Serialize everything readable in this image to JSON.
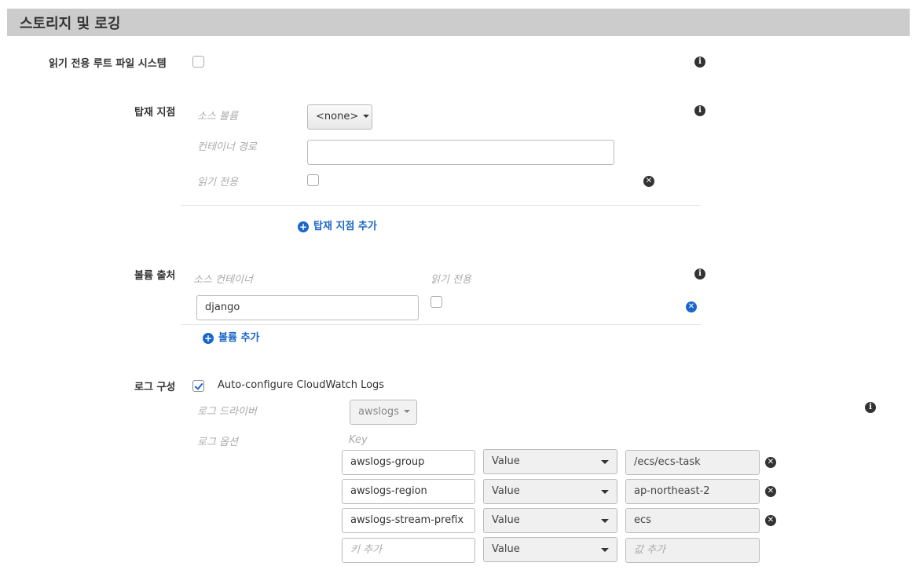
{
  "section": {
    "title": "스토리지 및 로깅"
  },
  "readonly_root": {
    "label": "읽기 전용 루트 파일 시스템",
    "checked": false
  },
  "mount_points": {
    "label": "탑재 지점",
    "source_volume_label": "소스 볼륨",
    "source_volume_value": "<none>",
    "container_path_label": "컨테이너 경로",
    "container_path_value": "",
    "read_only_label": "읽기 전용",
    "add_label": "탑재 지점 추가"
  },
  "volumes_from": {
    "label": "볼륨 출처",
    "source_container_label": "소스 컨테이너",
    "read_only_label": "읽기 전용",
    "source_container_value": "django",
    "add_label": "볼륨 추가"
  },
  "log_config": {
    "label": "로그 구성",
    "auto_configure_label": "Auto-configure CloudWatch Logs",
    "auto_configure_checked": true,
    "log_driver_label": "로그 드라이버",
    "log_driver_value": "awslogs",
    "log_options_label": "로그 옵션",
    "key_header": "Key",
    "options": [
      {
        "key": "awslogs-group",
        "type": "Value",
        "value": "/ecs/ecs-task"
      },
      {
        "key": "awslogs-region",
        "type": "Value",
        "value": "ap-northeast-2"
      },
      {
        "key": "awslogs-stream-prefix",
        "type": "Value",
        "value": "ecs"
      }
    ],
    "new_option": {
      "key_placeholder": "키 추가",
      "type": "Value",
      "value_placeholder": "값 추가"
    }
  },
  "icons": {
    "info": "info-icon",
    "remove": "remove-icon",
    "add": "add-icon",
    "check": "check-icon",
    "caret": "caret-down-icon"
  },
  "colors": {
    "header_bg": "#cccccc",
    "link": "#1a66c9",
    "icon_dark": "#333333"
  }
}
